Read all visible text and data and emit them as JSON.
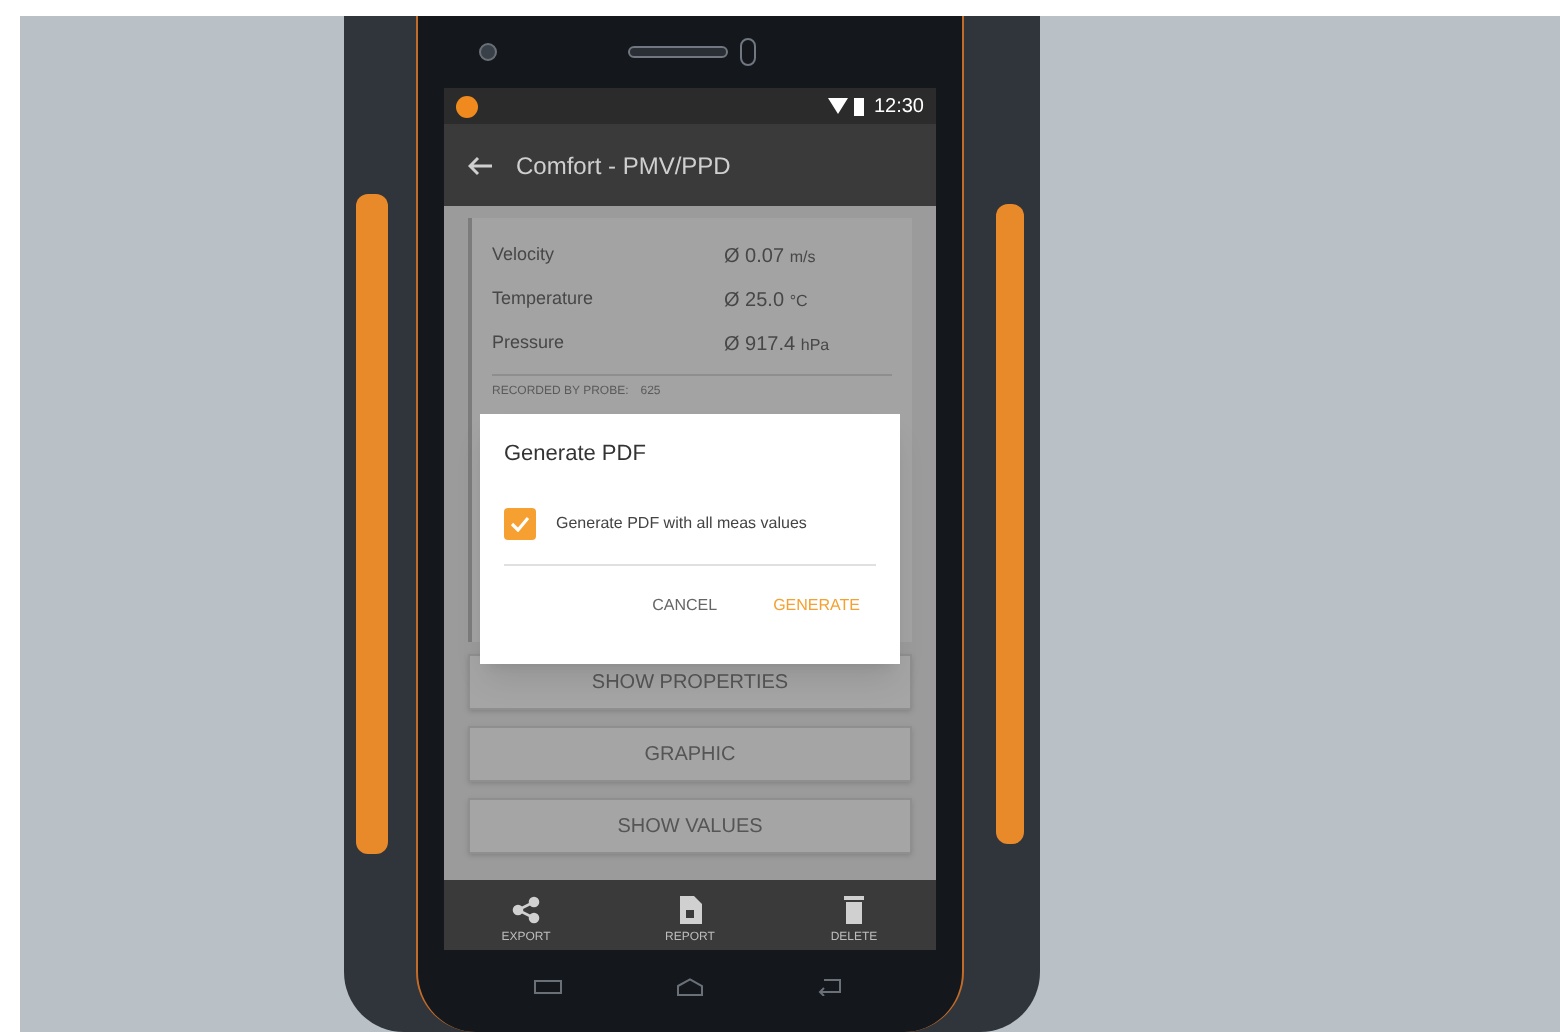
{
  "status_bar": {
    "time": "12:30"
  },
  "app_bar": {
    "title": "Comfort - PMV/PPD"
  },
  "measurements": [
    {
      "name": "Velocity",
      "value": "Ø 0.07",
      "unit": "m/s"
    },
    {
      "name": "Temperature",
      "value": "Ø 25.0",
      "unit": "°C"
    },
    {
      "name": "Pressure",
      "value": "Ø 917.4",
      "unit": "hPa"
    }
  ],
  "recorded_by": {
    "label": "RECORDED BY PROBE:",
    "value": "625"
  },
  "buttons": [
    "SHOW PROPERTIES",
    "GRAPHIC",
    "SHOW VALUES"
  ],
  "dialog": {
    "title": "Generate PDF",
    "option": {
      "label": "Generate PDF with all meas values",
      "checked": true
    },
    "actions": [
      {
        "label": "CANCEL",
        "kind": "secondary"
      },
      {
        "label": "GENERATE",
        "kind": "primary"
      }
    ]
  },
  "bottom_bar": [
    {
      "label": "EXPORT",
      "kind": "share"
    },
    {
      "label": "REPORT",
      "kind": "report"
    },
    {
      "label": "DELETE",
      "kind": "delete"
    }
  ]
}
